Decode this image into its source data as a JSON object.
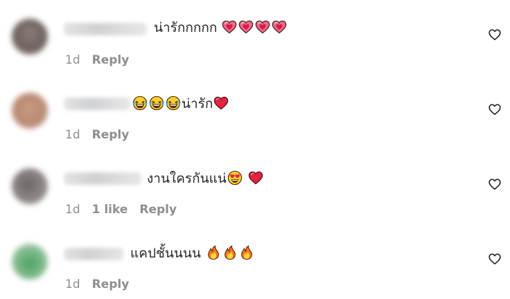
{
  "comments": [
    {
      "text": "น่ารักกกกก",
      "time": "1d",
      "likes": "",
      "reply_label": "Reply"
    },
    {
      "text": "น่ารัก",
      "time": "1d",
      "likes": "",
      "reply_label": "Reply"
    },
    {
      "text": "งานใครกันแน่",
      "time": "1d",
      "likes": "1 like",
      "reply_label": "Reply"
    },
    {
      "text": "แคปชั้นนนน",
      "time": "1d",
      "likes": "",
      "reply_label": "Reply"
    }
  ],
  "colors": {
    "text": "#262626",
    "meta": "#8e8e8e",
    "heart_red": "#e0245e",
    "heart_pink": "#f1677f",
    "fire_orange": "#f7901e"
  },
  "icons": {
    "like": "heart-outline-icon",
    "pink_heart": "sparkling-heart-emoji",
    "red_heart": "red-heart-emoji",
    "laugh": "grinning-squinting-face-emoji",
    "heart_eyes": "smiling-face-with-heart-eyes-emoji",
    "fire": "fire-emoji"
  }
}
